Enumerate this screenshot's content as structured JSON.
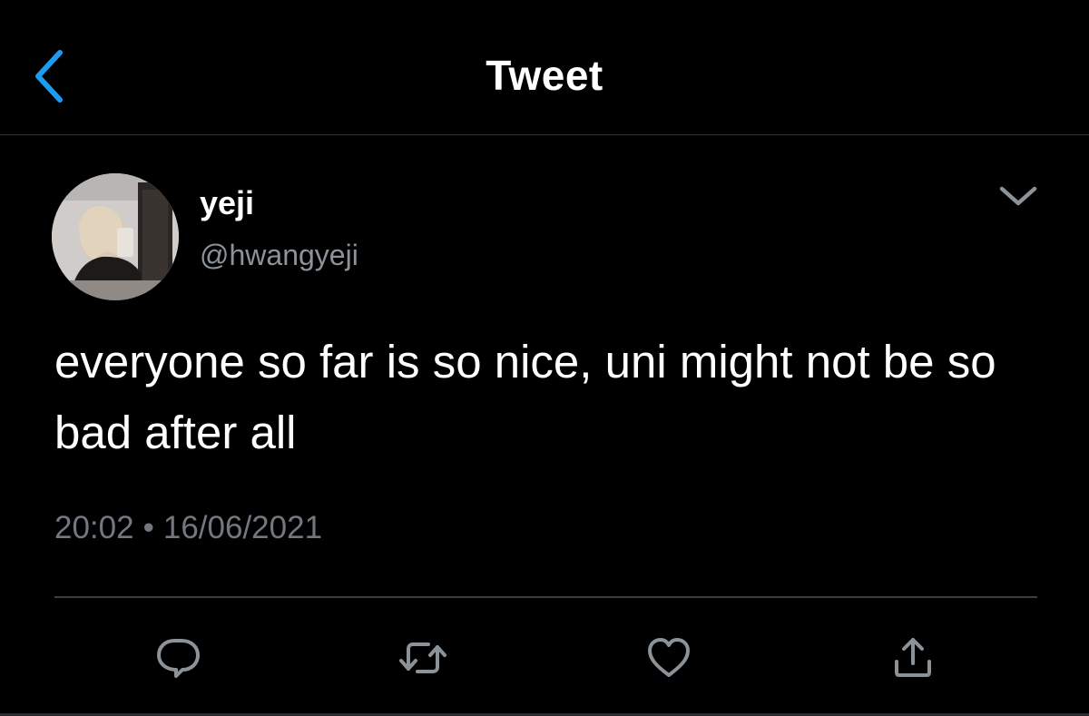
{
  "header": {
    "title": "Tweet",
    "back_icon": "chevron-left-icon"
  },
  "colors": {
    "accent": "#1d9bf0",
    "background": "#000000",
    "secondary_text": "#8b9298",
    "icon_gray": "#8b9298"
  },
  "tweet": {
    "author": {
      "display_name": "yeji",
      "handle": "@hwangyeji"
    },
    "text": "everyone so far is so nice, uni might not be so bad after all",
    "time": "20:02",
    "separator": "•",
    "date": "16/06/2021"
  },
  "actions": [
    {
      "name": "reply",
      "icon": "reply-icon"
    },
    {
      "name": "retweet",
      "icon": "retweet-icon"
    },
    {
      "name": "like",
      "icon": "heart-icon"
    },
    {
      "name": "share",
      "icon": "share-icon"
    }
  ]
}
